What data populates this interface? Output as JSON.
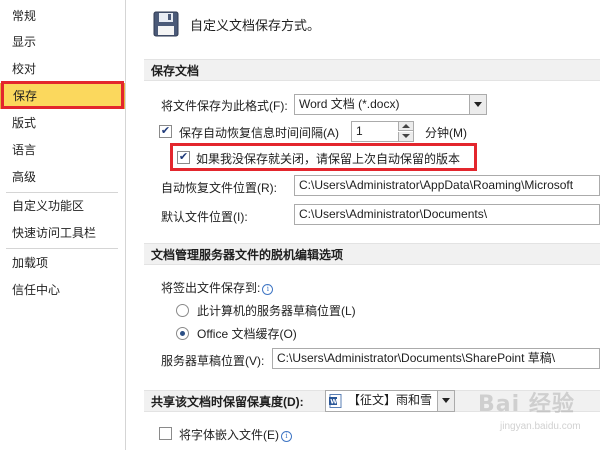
{
  "sidebar": {
    "items": [
      {
        "label": "常规"
      },
      {
        "label": "显示"
      },
      {
        "label": "校对"
      },
      {
        "label": "保存"
      },
      {
        "label": "版式"
      },
      {
        "label": "语言"
      },
      {
        "label": "高级"
      },
      {
        "label": "自定义功能区"
      },
      {
        "label": "快速访问工具栏"
      },
      {
        "label": "加载项"
      },
      {
        "label": "信任中心"
      }
    ],
    "selected": "保存",
    "selected_color": "#fbd85d"
  },
  "header": {
    "icon": "floppy-disk-icon",
    "title": "自定义文档保存方式。"
  },
  "save_section": {
    "heading": "保存文档",
    "format_label": "将文件保存为此格式(F):",
    "format_value": "Word 文档 (*.docx)",
    "autorecover_label": "保存自动恢复信息时间间隔(A)",
    "autorecover_checked": true,
    "autorecover_minutes": "1",
    "minutes_label": "分钟(M)",
    "keep_last_label": "如果我没保存就关闭，请保留上次自动保留的版本",
    "keep_last_checked": true,
    "autorecover_location_label": "自动恢复文件位置(R):",
    "autorecover_location_value": "C:\\Users\\Administrator\\AppData\\Roaming\\Microsoft",
    "default_location_label": "默认文件位置(I):",
    "default_location_value": "C:\\Users\\Administrator\\Documents\\"
  },
  "offline_section": {
    "heading": "文档管理服务器文件的脱机编辑选项",
    "checkout_label": "将签出文件保存到:",
    "option_server_drafts": "此计算机的服务器草稿位置(L)",
    "option_office_cache": "Office 文档缓存(O)",
    "selected_option": "Office 文档缓存(O)",
    "server_drafts_label": "服务器草稿位置(V):",
    "server_drafts_value": "C:\\Users\\Administrator\\Documents\\SharePoint 草稿\\"
  },
  "fidelity_section": {
    "heading": "共享该文档时保留保真度(D):",
    "document_value": "【征文】雨和雪",
    "embed_fonts_label": "将字体嵌入文件(E)",
    "embed_fonts_checked": false
  },
  "watermark": {
    "brand": "Bai 经验",
    "url": "jingyan.baidu.com"
  },
  "colors": {
    "highlight_border": "#e3262d",
    "section_background": "#f1f1f1"
  }
}
